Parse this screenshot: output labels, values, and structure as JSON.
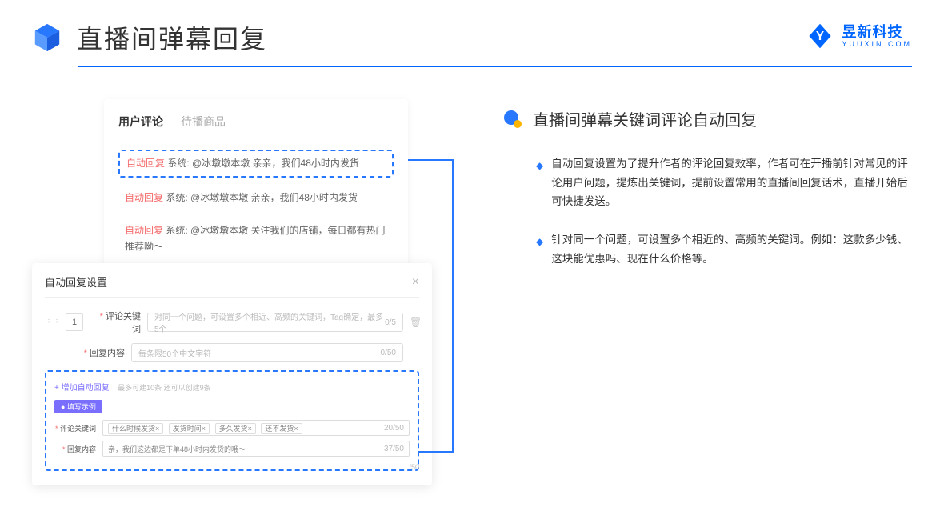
{
  "header": {
    "title": "直播间弹幕回复"
  },
  "brand": {
    "name": "昱新科技",
    "url": "YUUXIN.COM"
  },
  "card": {
    "tab_active": "用户评论",
    "tab_inactive": "待播商品",
    "comments": [
      {
        "tag": "自动回复",
        "body": "系统: @冰墩墩本墩 亲亲，我们48小时内发货"
      },
      {
        "tag": "自动回复",
        "body": "系统: @冰墩墩本墩 亲亲，我们48小时内发货"
      },
      {
        "tag": "自动回复",
        "body": "系统: @冰墩墩本墩 关注我们的店铺，每日都有热门推荐呦～"
      }
    ]
  },
  "dialog": {
    "title": "自动回复设置",
    "num": "1",
    "label_keyword": "评论关键词",
    "label_content": "回复内容",
    "placeholder_keyword": "对同一个问题，可设置多个相近、高频的关键词，Tag确定，最多5个",
    "placeholder_content": "每条限50个中文字符",
    "counter_kw": "0/5",
    "counter_ct": "0/50",
    "add_link": "+ 增加自动回复",
    "add_hint": "最多可建10条 还可以创建9条",
    "example_badge": "● 填写示例",
    "ex_tags": [
      "什么时候发货×",
      "发货时间×",
      "多久发货×",
      "还不发货×"
    ],
    "ex_tag_counter": "20/50",
    "ex_content": "亲，我们这边都是下单48小时内发货的哦～",
    "ex_content_counter": "37/50",
    "dangling_counter": "/50"
  },
  "right": {
    "title": "直播间弹幕关键词评论自动回复",
    "p1": "自动回复设置为了提升作者的评论回复效率，作者可在开播前针对常见的评论用户问题，提炼出关键词，提前设置常用的直播间回复话术，直播开始后可快捷发送。",
    "p2": "针对同一个问题，可设置多个相近的、高频的关键词。例如：这款多少钱、这块能优惠吗、现在什么价格等。"
  }
}
